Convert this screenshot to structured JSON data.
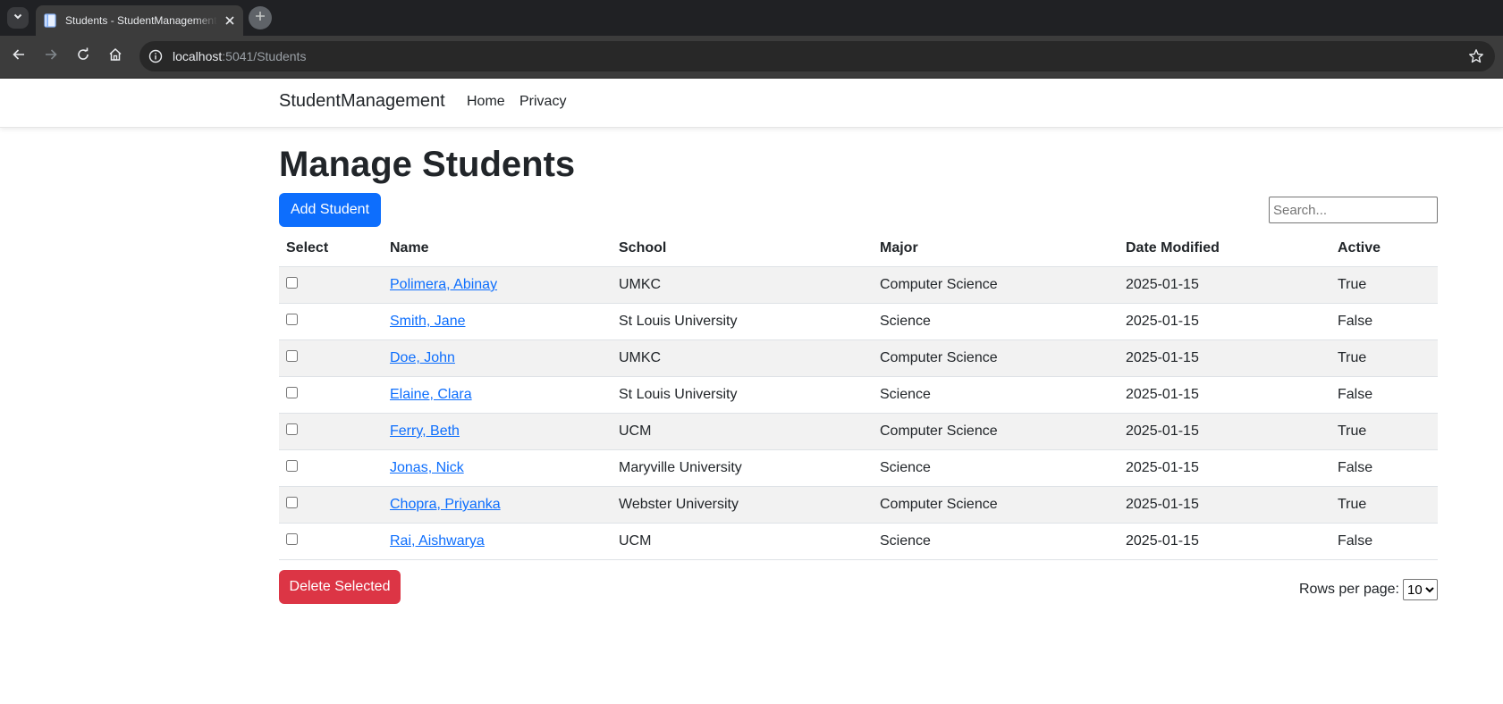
{
  "browser": {
    "tab_title": "Students - StudentManagement",
    "url_host": "localhost",
    "url_rest": ":5041/Students"
  },
  "navbar": {
    "brand": "StudentManagement",
    "links": [
      "Home",
      "Privacy"
    ]
  },
  "page": {
    "title": "Manage Students",
    "add_button": "Add Student",
    "search_placeholder": "Search...",
    "delete_button": "Delete Selected",
    "rows_per_page_label": "Rows per page:",
    "rows_per_page_value": "10"
  },
  "table": {
    "headers": [
      "Select",
      "Name",
      "School",
      "Major",
      "Date Modified",
      "Active"
    ],
    "rows": [
      {
        "name": "Polimera, Abinay",
        "school": "UMKC",
        "major": "Computer Science",
        "date": "2025-01-15",
        "active": "True"
      },
      {
        "name": "Smith, Jane",
        "school": "St Louis University",
        "major": "Science",
        "date": "2025-01-15",
        "active": "False"
      },
      {
        "name": "Doe, John",
        "school": "UMKC",
        "major": "Computer Science",
        "date": "2025-01-15",
        "active": "True"
      },
      {
        "name": "Elaine, Clara",
        "school": "St Louis University",
        "major": "Science",
        "date": "2025-01-15",
        "active": "False"
      },
      {
        "name": "Ferry, Beth",
        "school": "UCM",
        "major": "Computer Science",
        "date": "2025-01-15",
        "active": "True"
      },
      {
        "name": "Jonas, Nick",
        "school": "Maryville University",
        "major": "Science",
        "date": "2025-01-15",
        "active": "False"
      },
      {
        "name": "Chopra, Priyanka",
        "school": "Webster University",
        "major": "Computer Science",
        "date": "2025-01-15",
        "active": "True"
      },
      {
        "name": "Rai, Aishwarya",
        "school": "UCM",
        "major": "Science",
        "date": "2025-01-15",
        "active": "False"
      }
    ]
  },
  "colors": {
    "primary": "#0d6efd",
    "danger": "#dc3545",
    "chrome_dark": "#202124"
  },
  "icons": {
    "tab_menu": "chevron-down-icon",
    "favicon": "document-icon",
    "tab_close": "close-icon",
    "new_tab": "plus-icon",
    "back": "arrow-left-icon",
    "forward": "arrow-right-icon",
    "reload": "reload-icon",
    "home": "home-icon",
    "site_info": "info-icon",
    "bookmark": "star-icon"
  }
}
